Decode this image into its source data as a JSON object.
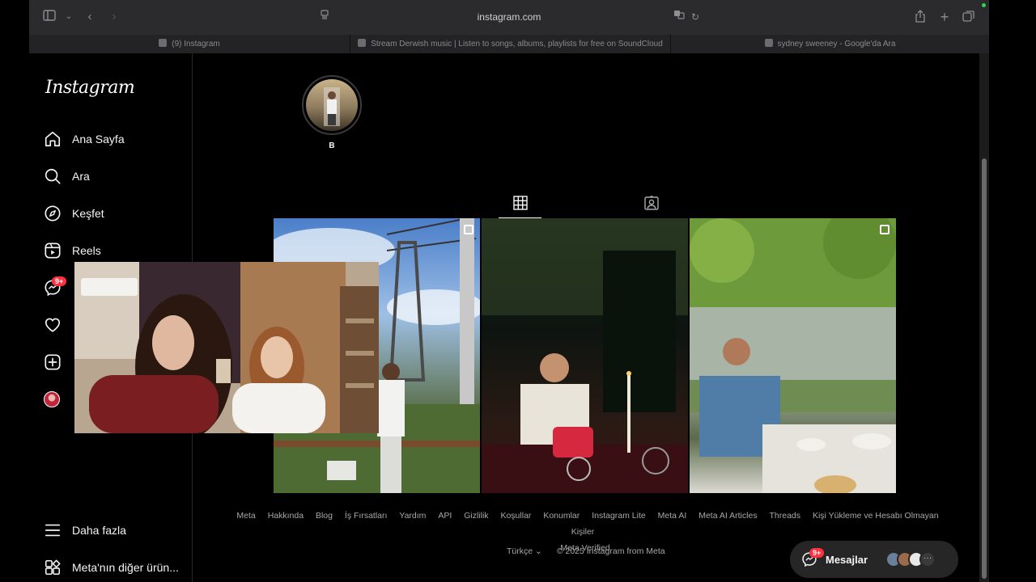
{
  "browser": {
    "url": "instagram.com",
    "tabs": [
      {
        "label": "(9) Instagram"
      },
      {
        "label": "Stream Derwish music | Listen to songs, albums, playlists for free on SoundCloud"
      },
      {
        "label": "sydney sweeney - Google'da Ara"
      }
    ]
  },
  "sidebar": {
    "logo": "Instagram",
    "items": [
      {
        "label": "Ana Sayfa",
        "icon": "home-icon"
      },
      {
        "label": "Ara",
        "icon": "search-icon"
      },
      {
        "label": "Keşfet",
        "icon": "compass-icon"
      },
      {
        "label": "Reels",
        "icon": "reels-icon"
      },
      {
        "label": "",
        "icon": "messenger-icon",
        "badge": "9+"
      },
      {
        "label": "",
        "icon": "heart-icon"
      },
      {
        "label": "",
        "icon": "plus-square-icon"
      },
      {
        "label": "",
        "icon": "profile-avatar"
      }
    ],
    "more": "Daha fazla",
    "meta_products": "Meta'nın diğer ürün..."
  },
  "profile": {
    "highlight_label": "B"
  },
  "footer": {
    "links": [
      "Meta",
      "Hakkında",
      "Blog",
      "İş Fırsatları",
      "Yardım",
      "API",
      "Gizlilik",
      "Koşullar",
      "Konumlar",
      "Instagram Lite",
      "Meta AI",
      "Meta AI Articles",
      "Threads",
      "Kişi Yükleme ve Hesabı Olmayan Kişiler",
      "Meta Verified"
    ],
    "language": "Türkçe",
    "copyright": "© 2025 Instagram from Meta"
  },
  "messages": {
    "label": "Mesajlar",
    "badge": "9+"
  },
  "colors": {
    "background": "#000000",
    "badge": "#ff3040",
    "chrome": "#2b2b2d"
  }
}
